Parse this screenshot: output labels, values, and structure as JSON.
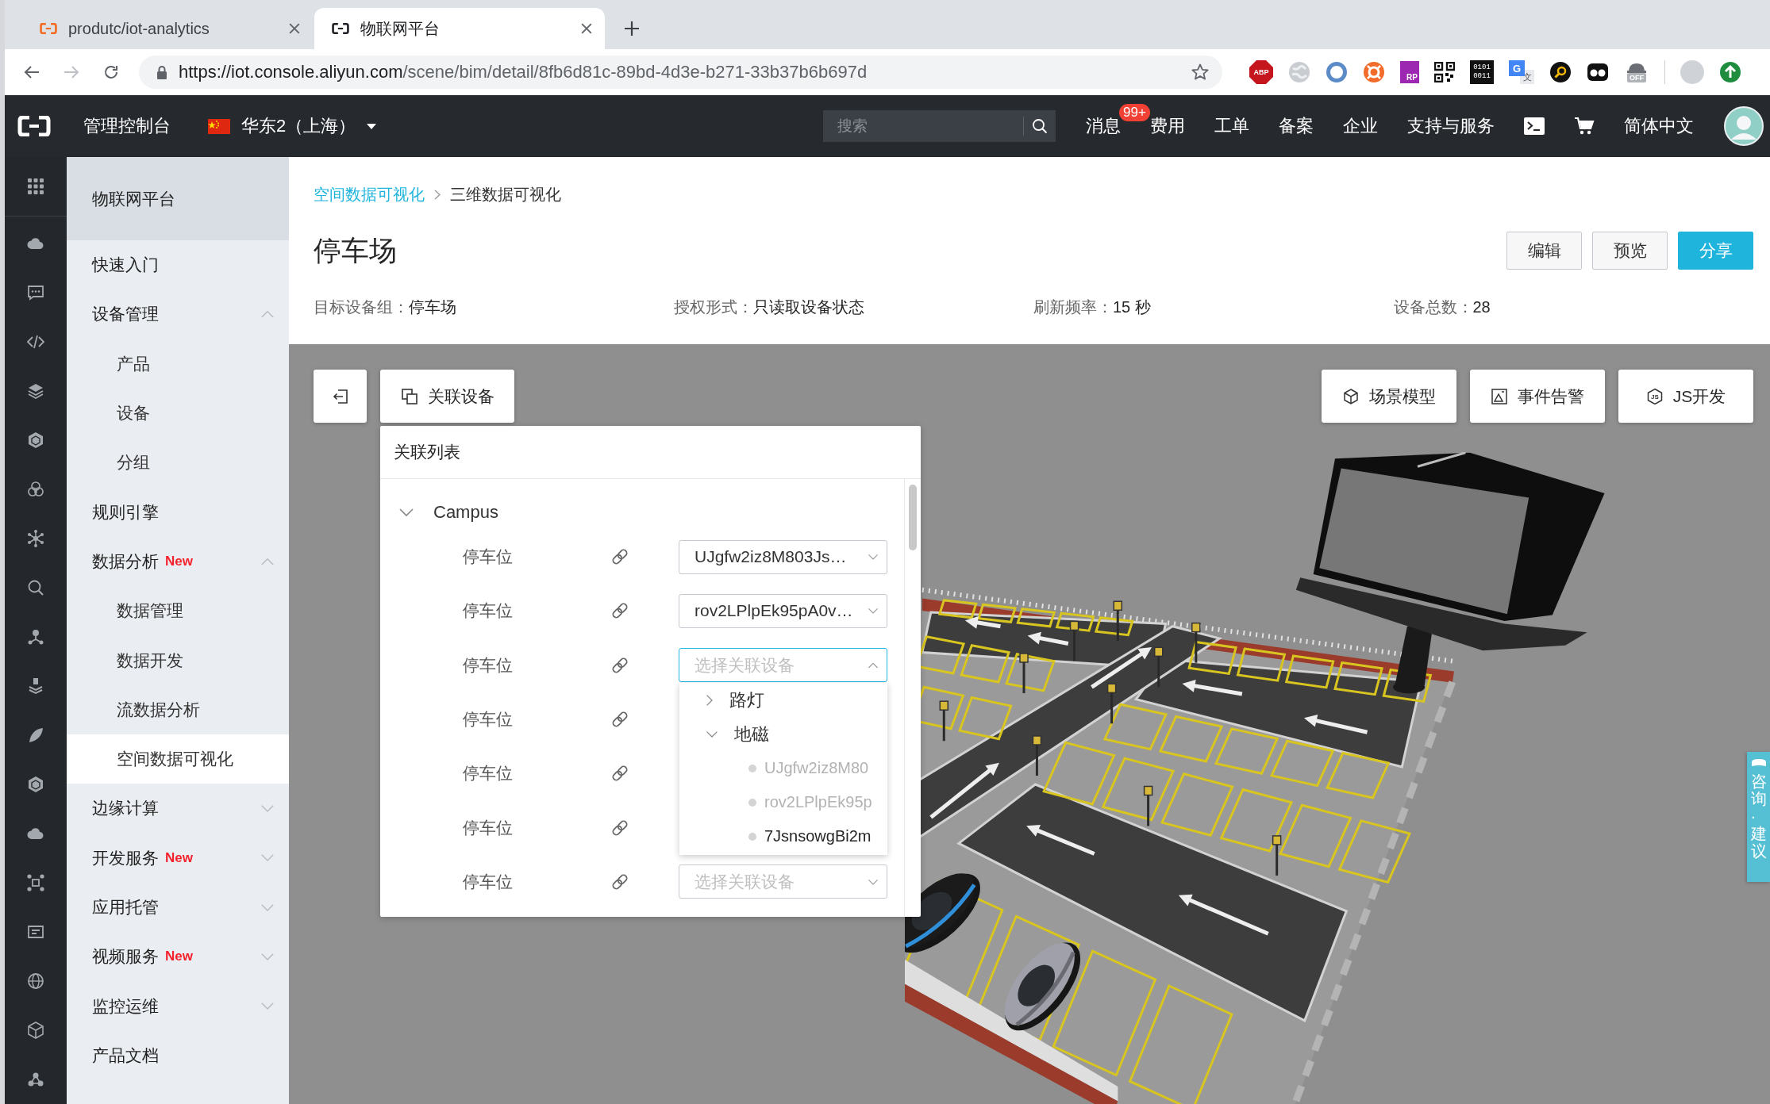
{
  "browser": {
    "tabs": [
      {
        "title": "produtc/iot-analytics",
        "selected": false
      },
      {
        "title": "物联网平台",
        "selected": true
      }
    ],
    "nav_buttons": [
      {
        "kind": "back",
        "disabled": false
      },
      {
        "kind": "forward",
        "disabled": true
      },
      {
        "kind": "reload",
        "disabled": false
      }
    ],
    "url": {
      "host": "https://iot.console.aliyun.com",
      "path": "/scene/bim/detail/8fb6d81c-89bd-4d3e-b271-33b37b6b697d"
    },
    "extensions": [
      {
        "kind": "abp",
        "texts": [
          "ABP"
        ]
      },
      {
        "kind": "globe"
      },
      {
        "kind": "ring"
      },
      {
        "kind": "lifebuoy"
      },
      {
        "kind": "rp",
        "texts": [
          "RP"
        ]
      },
      {
        "kind": "qr"
      },
      {
        "kind": "binary",
        "texts": [
          "0101",
          "0011"
        ]
      },
      {
        "kind": "translate",
        "texts": [
          "G",
          "文"
        ]
      },
      {
        "kind": "magnifier"
      },
      {
        "kind": "glasses"
      },
      {
        "kind": "incognito",
        "texts": [
          "OFF"
        ]
      },
      {
        "kind": "divider"
      },
      {
        "kind": "profile"
      },
      {
        "kind": "update"
      }
    ]
  },
  "topbar": {
    "console_label": "管理控制台",
    "region": "华东2（上海）",
    "search": {
      "placeholder": "搜索"
    },
    "items": [
      {
        "kind": "text",
        "label": "消息",
        "badge": "99+"
      },
      {
        "kind": "text",
        "label": "费用"
      },
      {
        "kind": "text",
        "label": "工单"
      },
      {
        "kind": "text",
        "label": "备案"
      },
      {
        "kind": "text",
        "label": "企业"
      },
      {
        "kind": "text",
        "label": "支持与服务"
      },
      {
        "kind": "terminal"
      },
      {
        "kind": "cart"
      },
      {
        "kind": "text",
        "label": "简体中文"
      }
    ]
  },
  "icon_rail": [
    {
      "kind": "grid"
    },
    {
      "kind": "cloud"
    },
    {
      "kind": "chat"
    },
    {
      "kind": "code"
    },
    {
      "kind": "layers"
    },
    {
      "kind": "hexagon"
    },
    {
      "kind": "rings"
    },
    {
      "kind": "network"
    },
    {
      "kind": "search"
    },
    {
      "kind": "nodes"
    },
    {
      "kind": "stack"
    },
    {
      "kind": "leaf"
    },
    {
      "kind": "hexagon"
    },
    {
      "kind": "cloud"
    },
    {
      "kind": "cluster"
    },
    {
      "kind": "console"
    },
    {
      "kind": "globe"
    },
    {
      "kind": "cube"
    },
    {
      "kind": "triad"
    }
  ],
  "sidebar": {
    "title": "物联网平台",
    "items": [
      {
        "label": "快速入门",
        "selected": false
      },
      {
        "label": "设备管理",
        "selected": false,
        "expanded": true,
        "children": [
          {
            "label": "产品",
            "selected": false
          },
          {
            "label": "设备",
            "selected": false
          },
          {
            "label": "分组",
            "selected": false
          }
        ]
      },
      {
        "label": "规则引擎",
        "selected": false
      },
      {
        "label": "数据分析",
        "tag": "New",
        "selected": false,
        "expanded": true,
        "children": [
          {
            "label": "数据管理",
            "selected": false
          },
          {
            "label": "数据开发",
            "selected": false
          },
          {
            "label": "流数据分析",
            "selected": false
          },
          {
            "label": "空间数据可视化",
            "selected": true
          }
        ]
      },
      {
        "label": "边缘计算",
        "selected": false,
        "expanded": false
      },
      {
        "label": "开发服务",
        "tag": "New",
        "selected": false,
        "expanded": false
      },
      {
        "label": "应用托管",
        "selected": false,
        "expanded": false
      },
      {
        "label": "视频服务",
        "tag": "New",
        "selected": false,
        "expanded": false
      },
      {
        "label": "监控运维",
        "selected": false,
        "expanded": false
      },
      {
        "label": "产品文档",
        "selected": false
      }
    ]
  },
  "page": {
    "breadcrumb": [
      {
        "label": "空间数据可视化",
        "kind": "link"
      },
      {
        "label": "三维数据可视化",
        "kind": "current"
      }
    ],
    "title": "停车场",
    "actions": [
      {
        "label": "编辑",
        "primary": false
      },
      {
        "label": "预览",
        "primary": false
      },
      {
        "label": "分享",
        "primary": true
      }
    ],
    "info": [
      {
        "label": "目标设备组：",
        "value": "停车场"
      },
      {
        "label": "授权形式：",
        "value": "只读取设备状态"
      },
      {
        "label": "刷新频率：",
        "value": "15 秒"
      },
      {
        "label": "设备总数：",
        "value": "28"
      }
    ]
  },
  "viewport": {
    "toolbar_left": [
      {
        "kind": "collapse"
      },
      {
        "kind": "devices",
        "label": "关联设备"
      }
    ],
    "toolbar_right": [
      {
        "kind": "model",
        "label": "场景模型"
      },
      {
        "kind": "alarm",
        "label": "事件告警"
      },
      {
        "kind": "script",
        "label": "JS开发",
        "icon_text": "JS"
      }
    ],
    "panel": {
      "title": "关联列表",
      "group": {
        "label": "Campus",
        "expanded": true,
        "children": [
          {
            "label": "停车位",
            "select": {
              "value": "UJgfw2iz8M803Js…",
              "open": false
            }
          },
          {
            "label": "停车位",
            "select": {
              "value": "rov2LPlpEk95pA0v…",
              "open": false
            }
          },
          {
            "label": "停车位",
            "select": {
              "placeholder": "选择关联设备",
              "open": true,
              "options": [
                {
                  "label": "路灯",
                  "expanded": false
                },
                {
                  "label": "地磁",
                  "expanded": true,
                  "children": [
                    {
                      "label": "UJgfw2iz8M80",
                      "disabled": true
                    },
                    {
                      "label": "rov2LPlpEk95p",
                      "disabled": true
                    },
                    {
                      "label": "7JsnsowgBi2m",
                      "disabled": false
                    }
                  ]
                }
              ]
            }
          },
          {
            "label": "停车位"
          },
          {
            "label": "停车位"
          },
          {
            "label": "停车位"
          },
          {
            "label": "停车位",
            "select": {
              "placeholder": "选择关联设备",
              "open": false
            }
          }
        ]
      }
    },
    "feedback_tab": {
      "label": "咨询·建议"
    }
  }
}
